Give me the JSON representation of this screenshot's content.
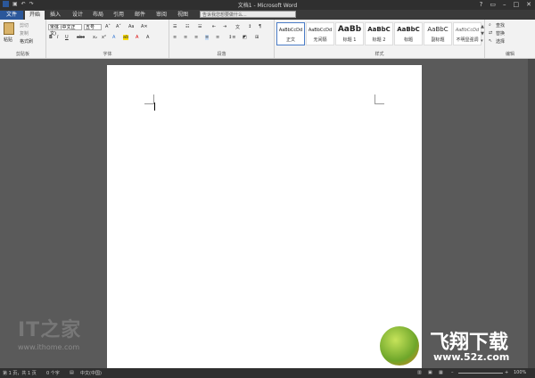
{
  "window": {
    "title": "文档1 - Microsoft Word"
  },
  "tabs": [
    {
      "label": "文件",
      "type": "file"
    },
    {
      "label": "开始",
      "type": "active"
    },
    {
      "label": "插入"
    },
    {
      "label": "设计"
    },
    {
      "label": "布局"
    },
    {
      "label": "引用"
    },
    {
      "label": "邮件"
    },
    {
      "label": "审阅"
    },
    {
      "label": "视图"
    }
  ],
  "tell_me": {
    "placeholder": "告诉我您想要做什么..."
  },
  "ribbon": {
    "clipboard": {
      "label": "剪贴板",
      "paste": "粘贴",
      "cut": "剪切",
      "copy": "复制",
      "format_painter": "格式刷"
    },
    "font": {
      "label": "字体",
      "font_name": "宋体 (中文正文)",
      "font_size": "五号",
      "bold": "B",
      "italic": "I",
      "underline": "U",
      "strike": "abc"
    },
    "paragraph": {
      "label": "段落"
    },
    "styles": {
      "label": "样式",
      "items": [
        {
          "sample": "AaBbCcDd",
          "name": "正文",
          "selected": true
        },
        {
          "sample": "AaBbCcDd",
          "name": "无间隔"
        },
        {
          "sample": "AaBb",
          "name": "标题 1"
        },
        {
          "sample": "AaBbC",
          "name": "标题 2"
        },
        {
          "sample": "AaBbC",
          "name": "标题"
        },
        {
          "sample": "AaBbC",
          "name": "副标题"
        },
        {
          "sample": "AaBbCcDd",
          "name": "不明显强调"
        }
      ]
    },
    "editing": {
      "label": "编辑",
      "find": "查找",
      "replace": "替换",
      "select": "选择"
    }
  },
  "status": {
    "page": "第 1 页，共 1 页",
    "words": "0 个字",
    "lang": "中文(中国)",
    "zoom": "100%"
  },
  "watermarks": {
    "ithome": "www.ithome.com",
    "site": "www.52z.com",
    "brand": "飞翔下载"
  },
  "colors": {
    "titlebar": "#2f2f2f",
    "file_tab": "#2b579a",
    "ribbon": "#f2f2f2",
    "workspace": "#5a5a5a"
  }
}
